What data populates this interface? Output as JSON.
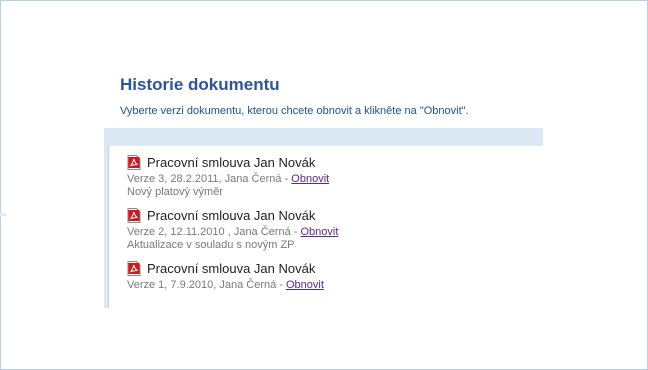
{
  "dialog": {
    "title": "Historie dokumentu",
    "instruction": "Vyberte verzi dokumentu, kterou chcete obnovit a klikněte na \"Obnovit\"."
  },
  "versions": [
    {
      "icon": "pdf-file-icon",
      "name": "Pracovní smlouva Jan Novák",
      "meta": "Verze 3, 28.2.2011, Jana Černá",
      "separator": " - ",
      "restore_label": "Obnovit",
      "note": "Nový platový výměr"
    },
    {
      "icon": "pdf-file-icon",
      "name": "Pracovní smlouva Jan Novák",
      "meta": "Verze 2, 12.11.2010 , Jana Černá",
      "separator": " - ",
      "restore_label": "Obnovit",
      "note": "Aktualizace v souladu s novým ZP"
    },
    {
      "icon": "pdf-file-icon",
      "name": "Pracovní smlouva Jan Novák",
      "meta": "Verze 1, 7.9.2010, Jana Černá",
      "separator": " - ",
      "restore_label": "Obnovit",
      "note": ""
    }
  ],
  "colors": {
    "title": "#2d5597",
    "link": "#5a2a8a",
    "panel_bg": "#dde8f5",
    "pdf_red": "#d0161e"
  }
}
